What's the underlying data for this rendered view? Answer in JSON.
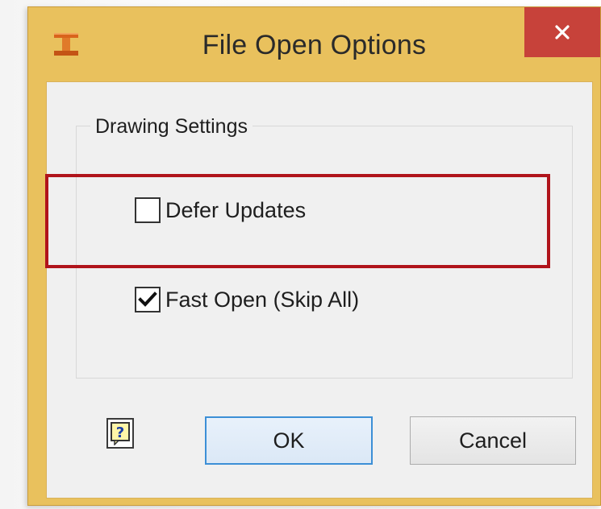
{
  "window": {
    "title": "File Open Options",
    "close_symbol": "×"
  },
  "group": {
    "legend": "Drawing Settings",
    "options": [
      {
        "label": "Defer Updates",
        "checked": false
      },
      {
        "label": "Fast Open (Skip All)",
        "checked": true
      }
    ]
  },
  "buttons": {
    "help_symbol": "?",
    "ok_label": "OK",
    "cancel_label": "Cancel"
  },
  "colors": {
    "frame": "#e9c15d",
    "close_button": "#c7423a",
    "highlight": "#b0141b",
    "default_button_border": "#3c8fd6"
  },
  "icons": {
    "app": "inventor-app-icon",
    "close": "close-icon",
    "help": "help-icon",
    "check": "checkmark-icon"
  }
}
